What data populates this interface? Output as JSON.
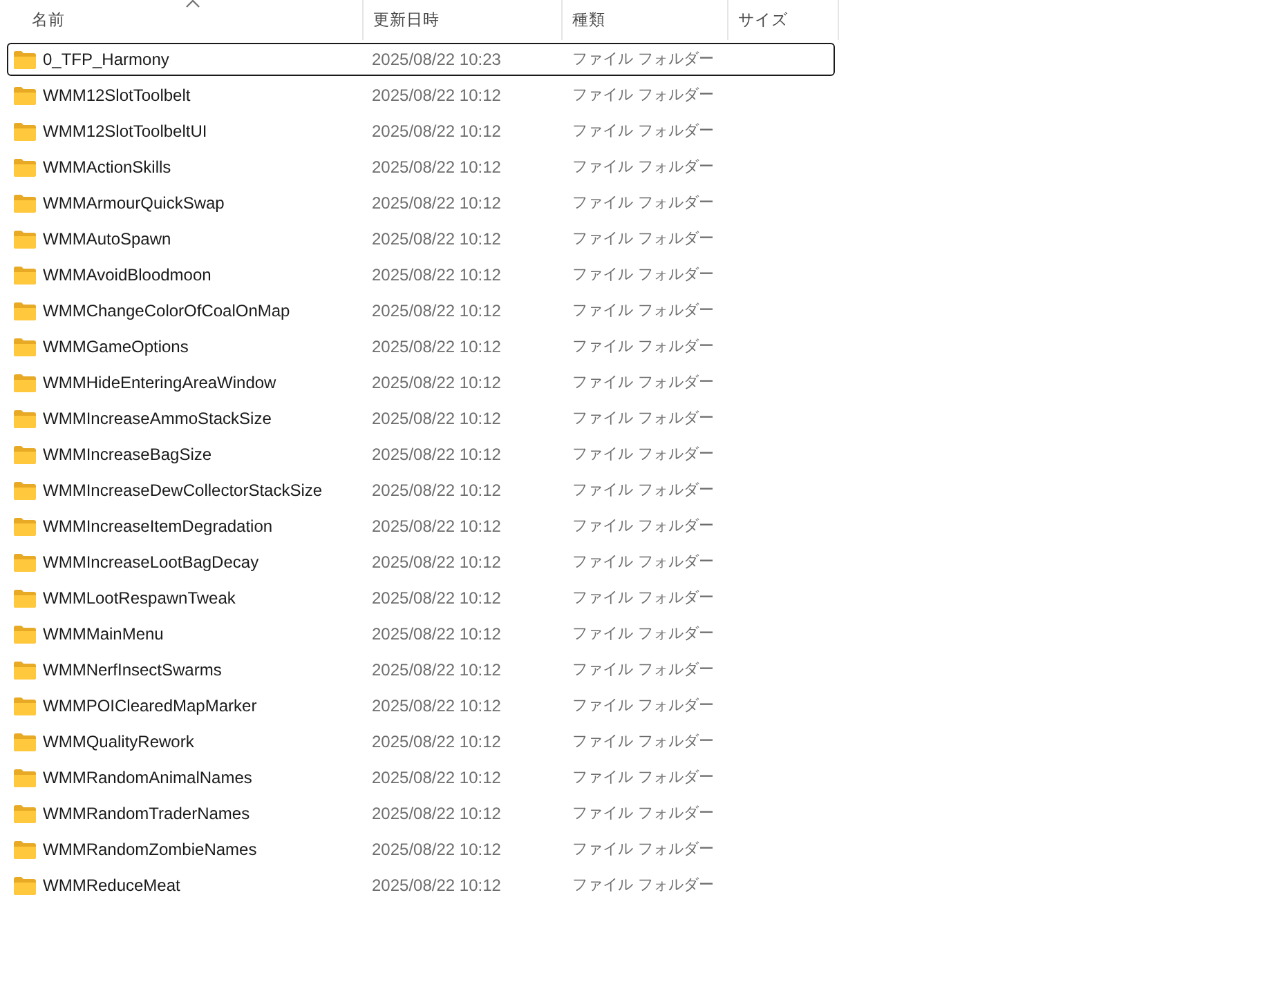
{
  "columns": [
    {
      "label": "名前",
      "sorted": true
    },
    {
      "label": "更新日時",
      "sorted": false
    },
    {
      "label": "種類",
      "sorted": false
    },
    {
      "label": "サイズ",
      "sorted": false
    }
  ],
  "rows": [
    {
      "name": "0_TFP_Harmony",
      "modified": "2025/08/22 10:23",
      "type": "ファイル フォルダー",
      "focused": true
    },
    {
      "name": "WMM12SlotToolbelt",
      "modified": "2025/08/22 10:12",
      "type": "ファイル フォルダー",
      "focused": false
    },
    {
      "name": "WMM12SlotToolbeltUI",
      "modified": "2025/08/22 10:12",
      "type": "ファイル フォルダー",
      "focused": false
    },
    {
      "name": "WMMActionSkills",
      "modified": "2025/08/22 10:12",
      "type": "ファイル フォルダー",
      "focused": false
    },
    {
      "name": "WMMArmourQuickSwap",
      "modified": "2025/08/22 10:12",
      "type": "ファイル フォルダー",
      "focused": false
    },
    {
      "name": "WMMAutoSpawn",
      "modified": "2025/08/22 10:12",
      "type": "ファイル フォルダー",
      "focused": false
    },
    {
      "name": "WMMAvoidBloodmoon",
      "modified": "2025/08/22 10:12",
      "type": "ファイル フォルダー",
      "focused": false
    },
    {
      "name": "WMMChangeColorOfCoalOnMap",
      "modified": "2025/08/22 10:12",
      "type": "ファイル フォルダー",
      "focused": false
    },
    {
      "name": "WMMGameOptions",
      "modified": "2025/08/22 10:12",
      "type": "ファイル フォルダー",
      "focused": false
    },
    {
      "name": "WMMHideEnteringAreaWindow",
      "modified": "2025/08/22 10:12",
      "type": "ファイル フォルダー",
      "focused": false
    },
    {
      "name": "WMMIncreaseAmmoStackSize",
      "modified": "2025/08/22 10:12",
      "type": "ファイル フォルダー",
      "focused": false
    },
    {
      "name": "WMMIncreaseBagSize",
      "modified": "2025/08/22 10:12",
      "type": "ファイル フォルダー",
      "focused": false
    },
    {
      "name": "WMMIncreaseDewCollectorStackSize",
      "modified": "2025/08/22 10:12",
      "type": "ファイル フォルダー",
      "focused": false
    },
    {
      "name": "WMMIncreaseItemDegradation",
      "modified": "2025/08/22 10:12",
      "type": "ファイル フォルダー",
      "focused": false
    },
    {
      "name": "WMMIncreaseLootBagDecay",
      "modified": "2025/08/22 10:12",
      "type": "ファイル フォルダー",
      "focused": false
    },
    {
      "name": "WMMLootRespawnTweak",
      "modified": "2025/08/22 10:12",
      "type": "ファイル フォルダー",
      "focused": false
    },
    {
      "name": "WMMMainMenu",
      "modified": "2025/08/22 10:12",
      "type": "ファイル フォルダー",
      "focused": false
    },
    {
      "name": "WMMNerfInsectSwarms",
      "modified": "2025/08/22 10:12",
      "type": "ファイル フォルダー",
      "focused": false
    },
    {
      "name": "WMMPOIClearedMapMarker",
      "modified": "2025/08/22 10:12",
      "type": "ファイル フォルダー",
      "focused": false
    },
    {
      "name": "WMMQualityRework",
      "modified": "2025/08/22 10:12",
      "type": "ファイル フォルダー",
      "focused": false
    },
    {
      "name": "WMMRandomAnimalNames",
      "modified": "2025/08/22 10:12",
      "type": "ファイル フォルダー",
      "focused": false
    },
    {
      "name": "WMMRandomTraderNames",
      "modified": "2025/08/22 10:12",
      "type": "ファイル フォルダー",
      "focused": false
    },
    {
      "name": "WMMRandomZombieNames",
      "modified": "2025/08/22 10:12",
      "type": "ファイル フォルダー",
      "focused": false
    },
    {
      "name": "WMMReduceMeat",
      "modified": "2025/08/22 10:12",
      "type": "ファイル フォルダー",
      "focused": false
    }
  ]
}
